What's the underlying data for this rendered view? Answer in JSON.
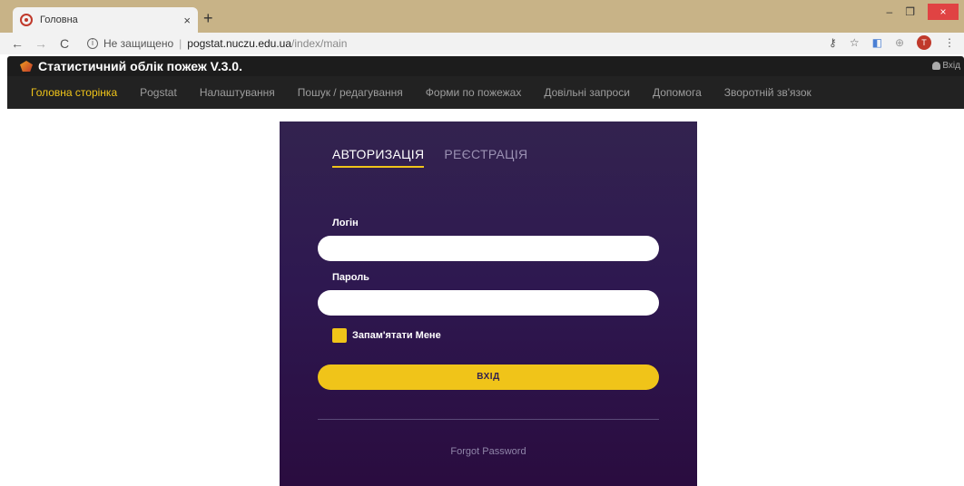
{
  "browser": {
    "tab_title": "Головна",
    "tab_close": "×",
    "new_tab": "+",
    "minimize": "–",
    "restore": "❐",
    "close": "×",
    "back": "←",
    "forward": "→",
    "reload": "C",
    "security_label": "Не защищено",
    "url_host": "pogstat.nuczu.edu.ua",
    "url_path": "/index/main",
    "profile_initial": "T",
    "icons": [
      "info-icon",
      "key-icon",
      "star-icon",
      "translate-icon",
      "globe-icon",
      "profile-icon",
      "menu-dots-icon"
    ]
  },
  "app": {
    "title": "Статистичний облік пожеж V.3.0.",
    "login_link": "Вхід"
  },
  "menu": {
    "items": [
      {
        "label": "Головна сторінка",
        "active": true
      },
      {
        "label": "Pogstat",
        "active": false
      },
      {
        "label": "Налаштування",
        "active": false
      },
      {
        "label": "Пошук / редагування",
        "active": false
      },
      {
        "label": "Форми по пожежах",
        "active": false
      },
      {
        "label": "Довільні запроси",
        "active": false
      },
      {
        "label": "Допомога",
        "active": false
      },
      {
        "label": "Зворотній зв'язок",
        "active": false
      }
    ]
  },
  "login": {
    "tab_auth": "АВТОРИЗАЦІЯ",
    "tab_register": "РЕЄСТРАЦІЯ",
    "login_label": "Логін",
    "login_value": "",
    "password_label": "Пароль",
    "password_value": "",
    "remember_label": "Запам'ятати Мене",
    "remember_checked": true,
    "submit_label": "ВХІД",
    "forgot_label": "Forgot Password"
  },
  "colors": {
    "accent": "#f0c419",
    "card_top": "#33234f",
    "card_bottom": "#2a0c3f",
    "menubar": "#222222"
  }
}
